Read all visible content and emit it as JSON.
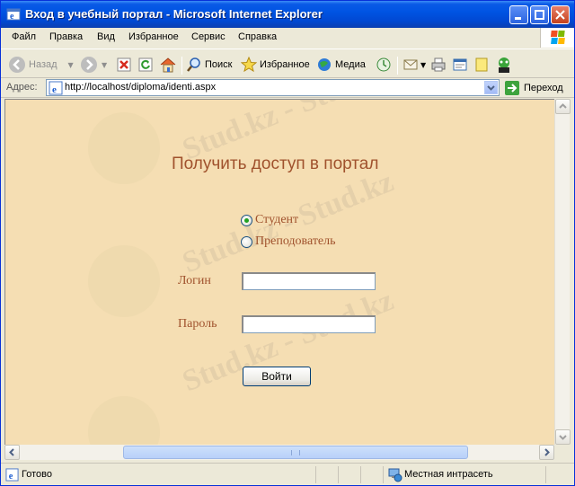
{
  "window": {
    "title": "Вход в учебный портал - Microsoft Internet Explorer"
  },
  "menu": {
    "items": [
      "Файл",
      "Правка",
      "Вид",
      "Избранное",
      "Сервис",
      "Справка"
    ]
  },
  "toolbar": {
    "back_label": "Назад",
    "search_label": "Поиск",
    "favorites_label": "Избранное",
    "media_label": "Медиа"
  },
  "address": {
    "label": "Адрес:",
    "url": "http://localhost/diploma/identi.aspx",
    "go_label": "Переход"
  },
  "page": {
    "heading": "Получить доступ в портал",
    "roles": [
      {
        "label": "Студент",
        "checked": true
      },
      {
        "label": "Преподователь",
        "checked": false
      }
    ],
    "login_label": "Логин",
    "login_value": "",
    "password_label": "Пароль",
    "password_value": "",
    "submit_label": "Войти",
    "watermark_text": "Stud.kz - Stud.kz"
  },
  "status": {
    "text": "Готово",
    "zone": "Местная интрасеть"
  },
  "colors": {
    "page_background": "#f5deb3",
    "text_accent": "#a0522d",
    "titlebar": "#0054e3"
  }
}
